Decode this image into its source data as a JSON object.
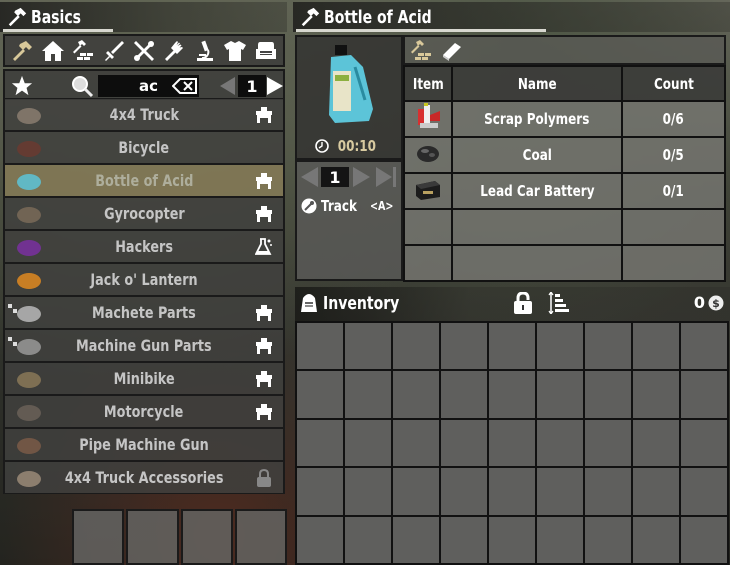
{
  "left_panel": {
    "title": "Basics",
    "title_icon": "hammer-icon",
    "categories": [
      {
        "name": "basics",
        "icon": "hammer-icon",
        "selected": true
      },
      {
        "name": "building",
        "icon": "house-icon",
        "selected": false
      },
      {
        "name": "resources",
        "icon": "hammer-bricks-icon",
        "selected": false
      },
      {
        "name": "weapons",
        "icon": "sword-icon",
        "selected": false
      },
      {
        "name": "tools",
        "icon": "tools-icon",
        "selected": false
      },
      {
        "name": "food",
        "icon": "fork-icon",
        "selected": false
      },
      {
        "name": "science",
        "icon": "microscope-icon",
        "selected": false
      },
      {
        "name": "clothing",
        "icon": "shirt-icon",
        "selected": false
      },
      {
        "name": "decor",
        "icon": "armchair-icon",
        "selected": false
      }
    ],
    "search": {
      "favorites_icon": "star-icon",
      "search_icon": "magnifier-icon",
      "value": "ac",
      "clear_icon": "backspace-icon",
      "page": "1"
    },
    "recipes": [
      {
        "name": "4x4 Truck",
        "thumb": "truck",
        "station": "workbench-icon",
        "selected": false,
        "unlock_mark": false
      },
      {
        "name": "Bicycle",
        "thumb": "bicycle",
        "station": "",
        "selected": false,
        "unlock_mark": false
      },
      {
        "name": "Bottle of Acid",
        "thumb": "acid-bottle",
        "station": "workbench-icon",
        "selected": true,
        "unlock_mark": false
      },
      {
        "name": "Gyrocopter",
        "thumb": "gyrocopter",
        "station": "workbench-icon",
        "selected": false,
        "unlock_mark": false
      },
      {
        "name": "Hackers",
        "thumb": "magazine",
        "station": "chemistry-station-icon",
        "selected": false,
        "unlock_mark": false
      },
      {
        "name": "Jack o' Lantern",
        "thumb": "pumpkin",
        "station": "",
        "selected": false,
        "unlock_mark": false
      },
      {
        "name": "Machete Parts",
        "thumb": "machete",
        "station": "workbench-icon",
        "selected": false,
        "unlock_mark": true
      },
      {
        "name": "Machine Gun Parts",
        "thumb": "gun-parts",
        "station": "workbench-icon",
        "selected": false,
        "unlock_mark": true
      },
      {
        "name": "Minibike",
        "thumb": "minibike",
        "station": "workbench-icon",
        "selected": false,
        "unlock_mark": false
      },
      {
        "name": "Motorcycle",
        "thumb": "motorcycle",
        "station": "workbench-icon",
        "selected": false,
        "unlock_mark": false
      },
      {
        "name": "Pipe Machine Gun",
        "thumb": "pipe-gun",
        "station": "",
        "selected": false,
        "unlock_mark": false
      },
      {
        "name": "4x4 Truck Accessories",
        "thumb": "truck-accessories",
        "station": "lock-icon",
        "selected": false,
        "unlock_mark": false
      }
    ],
    "tool_slots": 4
  },
  "detail_panel": {
    "title": "Bottle of Acid",
    "title_icon": "hammer-icon",
    "craft_time": "00:10",
    "quantity": "1",
    "track_label": "Track",
    "track_hotkey": "<A>",
    "tabs": [
      {
        "name": "ingredients",
        "icon": "hammer-bricks-icon"
      },
      {
        "name": "description",
        "icon": "book-icon"
      }
    ],
    "table": {
      "headers": {
        "item": "Item",
        "name": "Name",
        "count": "Count"
      },
      "rows": [
        {
          "icon": "scrap-polymers",
          "name": "Scrap Polymers",
          "count": "0/6"
        },
        {
          "icon": "coal",
          "name": "Coal",
          "count": "0/5"
        },
        {
          "icon": "car-battery",
          "name": "Lead Car Battery",
          "count": "0/1"
        },
        {
          "icon": "",
          "name": "",
          "count": ""
        },
        {
          "icon": "",
          "name": "",
          "count": ""
        }
      ]
    }
  },
  "inventory": {
    "title": "Inventory",
    "money": "0",
    "columns": 9,
    "rows": 5
  },
  "colors": {
    "selected_row": "#847a56",
    "selected_category": "#d8c89a",
    "craft_time": "#d8caa0"
  }
}
